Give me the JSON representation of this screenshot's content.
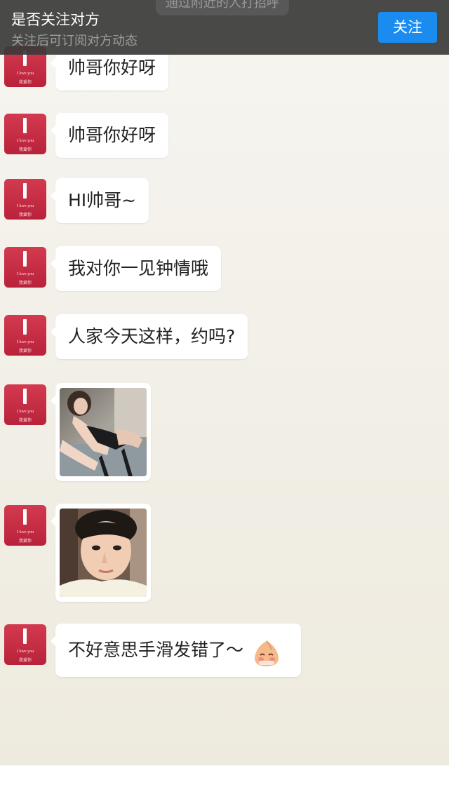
{
  "banner": {
    "hint": "通过附近的人打招呼",
    "title": "是否关注对方",
    "subtitle": "关注后可订阅对方动态",
    "follow_label": "关注",
    "follow_color": "#1a8cf0"
  },
  "avatar": {
    "line1": "I love you",
    "line2": "我爱你",
    "color": "#c42d44"
  },
  "messages": [
    {
      "type": "text",
      "text": "帅哥你好呀"
    },
    {
      "type": "text",
      "text": "帅哥你好呀"
    },
    {
      "type": "text",
      "text": "HI帅哥~"
    },
    {
      "type": "text",
      "text": "我对你一见钟情哦"
    },
    {
      "type": "text",
      "text": "人家今天这样，约吗?"
    },
    {
      "type": "image",
      "description": "photo-woman-lingerie"
    },
    {
      "type": "image",
      "description": "photo-man-selfie"
    },
    {
      "type": "text",
      "text": "不好意思手滑发错了～",
      "emoji": "blushing-emoji-icon"
    }
  ]
}
